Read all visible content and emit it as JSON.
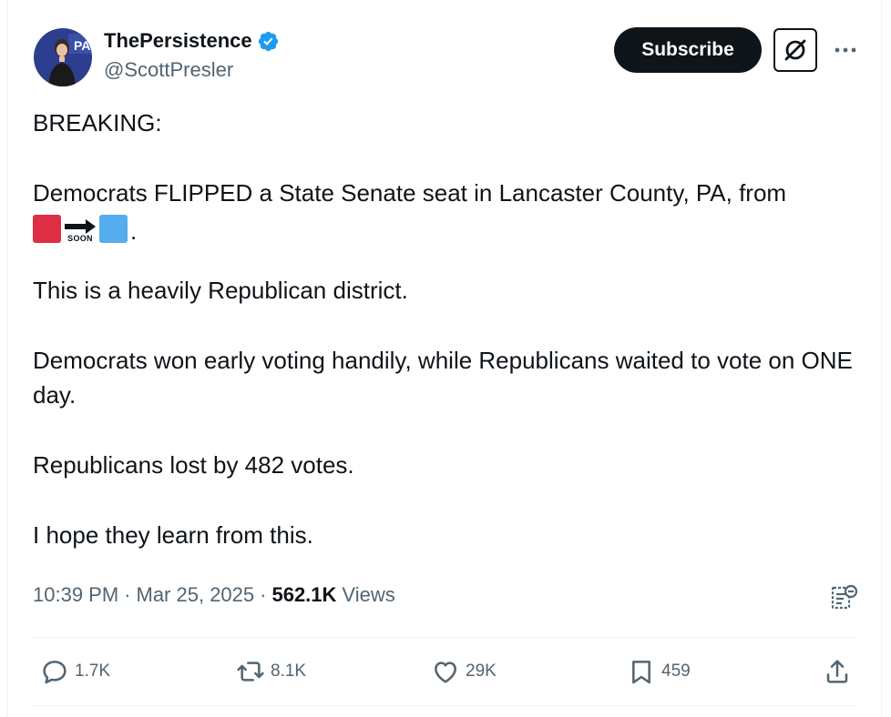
{
  "tweet": {
    "author": {
      "display_name": "ThePersistence",
      "handle": "@ScottPresler",
      "verified": true
    },
    "subscribe_label": "Subscribe",
    "paragraphs": [
      "BREAKING:",
      "Democrats FLIPPED a State Senate seat in Lancaster County, PA, from",
      "This is a heavily Republican district.",
      "Democrats won early voting handily, while Republicans waited to vote on ONE day.",
      "Republicans lost by 482 votes.",
      "I hope they learn from this."
    ],
    "emoji_sequence": {
      "from": "red-square",
      "arrow_label": "SOON",
      "to": "blue-square",
      "punctuation": "."
    },
    "meta": {
      "time": "10:39 PM",
      "separator": "·",
      "date": "Mar 25, 2025",
      "views_count": "562.1K",
      "views_label": "Views"
    },
    "stats": {
      "replies": "1.7K",
      "reposts": "8.1K",
      "likes": "29K",
      "bookmarks": "459"
    }
  },
  "colors": {
    "text_primary": "#0f1419",
    "text_secondary": "#536471",
    "verified_blue": "#1d9bf0",
    "divider": "#eff3f4",
    "red_square": "#dd2e44",
    "blue_square": "#55acee"
  },
  "icons": [
    "verified-badge-icon",
    "grok-icon",
    "more-icon",
    "analytics-icon",
    "reply-icon",
    "repost-icon",
    "like-icon",
    "bookmark-icon",
    "share-icon"
  ]
}
